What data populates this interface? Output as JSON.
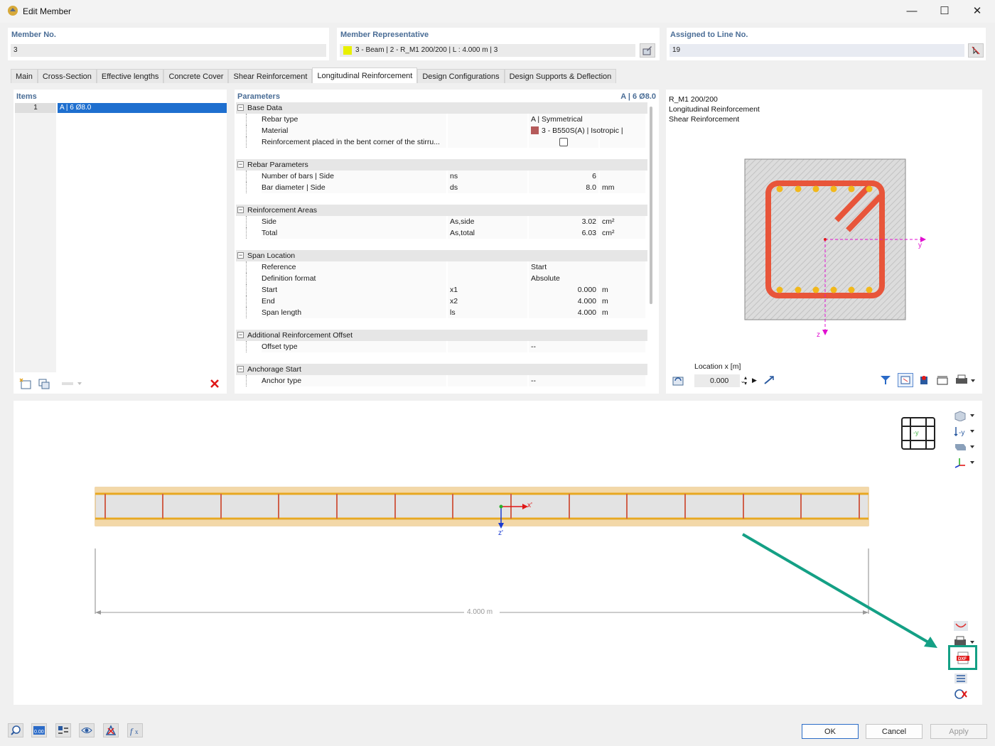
{
  "window": {
    "title": "Edit Member",
    "minimize": "—",
    "maximize": "☐",
    "close": "✕"
  },
  "header": {
    "member_no": {
      "label": "Member No.",
      "value": "3"
    },
    "member_rep": {
      "label": "Member Representative",
      "value": "3 - Beam | 2 - R_M1 200/200 | L : 4.000 m | 3",
      "swatch": "#e8f000"
    },
    "assigned": {
      "label": "Assigned to Line No.",
      "value": "19"
    }
  },
  "tabs": [
    {
      "label": "Main"
    },
    {
      "label": "Cross-Section"
    },
    {
      "label": "Effective lengths"
    },
    {
      "label": "Concrete Cover"
    },
    {
      "label": "Shear Reinforcement"
    },
    {
      "label": "Longitudinal Reinforcement"
    },
    {
      "label": "Design Configurations"
    },
    {
      "label": "Design Supports & Deflection"
    }
  ],
  "items": {
    "header": "Items",
    "rows": [
      {
        "no": "1",
        "label": "A | 6 Ø8.0"
      }
    ]
  },
  "parameters": {
    "header": "Parameters",
    "header_right": "A | 6 Ø8.0",
    "groups": {
      "base": "Base Data",
      "rebar": "Rebar Parameters",
      "areas": "Reinforcement Areas",
      "span": "Span Location",
      "offset": "Additional Reinforcement Offset",
      "anchor": "Anchorage Start"
    },
    "rows": {
      "rebar_type": {
        "name": "Rebar type",
        "value": "A | Symmetrical"
      },
      "material": {
        "name": "Material",
        "value": "3 - B550S(A) | Isotropic | Line...",
        "swatch": "#b55a5a"
      },
      "bent_corner": {
        "name": "Reinforcement placed in the bent corner of the stirru..."
      },
      "num_bars": {
        "name": "Number of bars | Side",
        "sym": "ns",
        "value": "6"
      },
      "bar_dia": {
        "name": "Bar diameter | Side",
        "sym": "ds",
        "value": "8.0",
        "unit": "mm"
      },
      "side": {
        "name": "Side",
        "sym": "As,side",
        "value": "3.02",
        "unit": "cm²"
      },
      "total": {
        "name": "Total",
        "sym": "As,total",
        "value": "6.03",
        "unit": "cm²"
      },
      "reference": {
        "name": "Reference",
        "value": "Start"
      },
      "def_format": {
        "name": "Definition format",
        "value": "Absolute"
      },
      "start": {
        "name": "Start",
        "sym": "x1",
        "value": "0.000",
        "unit": "m"
      },
      "end": {
        "name": "End",
        "sym": "x2",
        "value": "4.000",
        "unit": "m"
      },
      "span_len": {
        "name": "Span length",
        "sym": "ls",
        "value": "4.000",
        "unit": "m"
      },
      "offset_type": {
        "name": "Offset type",
        "value": "--"
      },
      "anchor_type": {
        "name": "Anchor type",
        "value": "--"
      }
    }
  },
  "preview": {
    "lines": [
      "R_M1 200/200",
      "Longitudinal Reinforcement",
      "Shear Reinforcement"
    ],
    "axis_y": "y",
    "axis_z": "z",
    "location_label": "Location x [m]",
    "location_value": "0.000"
  },
  "elevation": {
    "axis_x": "x'",
    "axis_z": "z'",
    "dimension": "4.000 m",
    "view_cube_label": "-y"
  },
  "buttons": {
    "ok": "OK",
    "cancel": "Cancel",
    "apply": "Apply"
  },
  "colors": {
    "accent": "#1e6fcf",
    "header_label": "#4a6d96",
    "highlight": "#14a085",
    "rebar": "#e8553a",
    "bar_dot": "#f2b81a"
  }
}
